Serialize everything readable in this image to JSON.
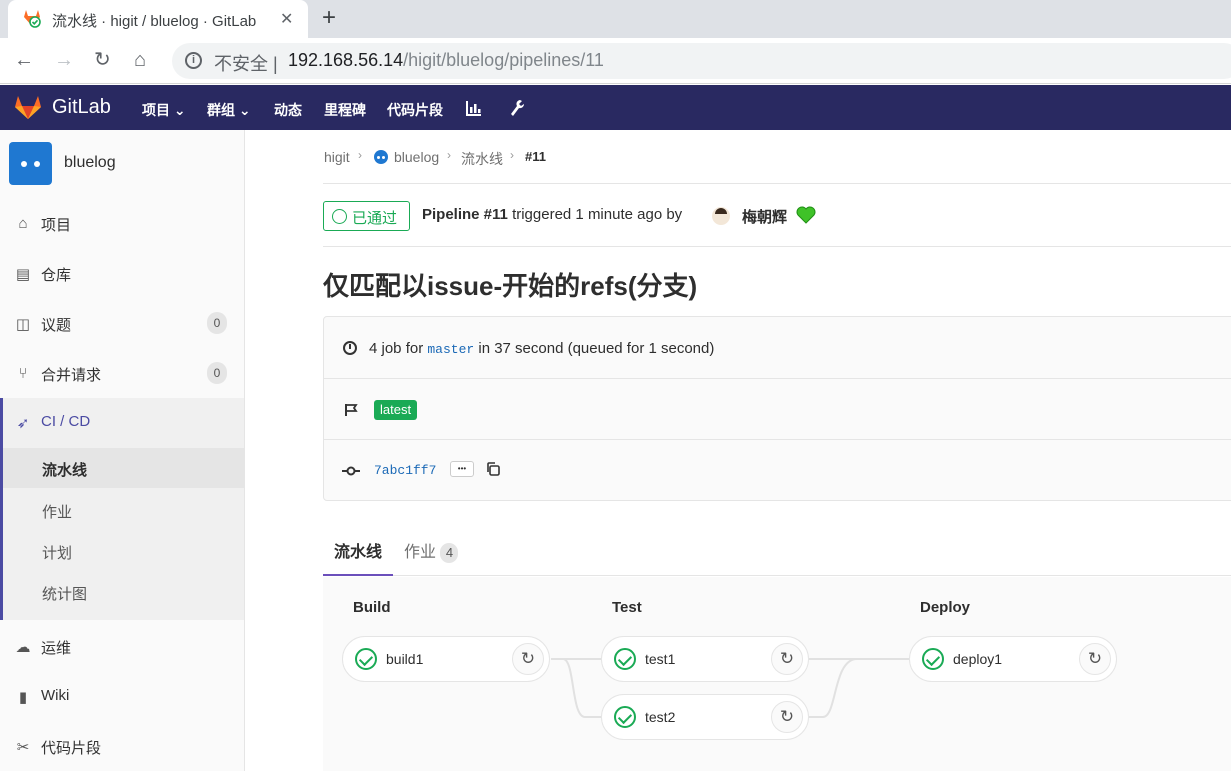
{
  "browser": {
    "tab_title": "流水线 · higit / bluelog · GitLab",
    "tab_close": "✕",
    "new_tab": "+",
    "nav": {
      "back": "←",
      "forward": "→",
      "reload": "↻",
      "home": "⌂"
    },
    "security_label": "不安全",
    "url_host": "192.168.56.14",
    "url_path": "/higit/bluelog/pipelines/11"
  },
  "header": {
    "brand": "GitLab",
    "nav": [
      "项目",
      "群组",
      "动态",
      "里程碑",
      "代码片段"
    ]
  },
  "sidebar": {
    "project_name": "bluelog",
    "items": [
      {
        "label": "项目",
        "icon": "home-icon"
      },
      {
        "label": "仓库",
        "icon": "doc-icon"
      },
      {
        "label": "议题",
        "icon": "issues-icon",
        "count": "0"
      },
      {
        "label": "合并请求",
        "icon": "merge-request-icon",
        "count": "0"
      },
      {
        "label": "CI / CD",
        "icon": "rocket-icon"
      },
      {
        "label": "运维",
        "icon": "cloud-gear-icon"
      },
      {
        "label": "Wiki",
        "icon": "book-icon"
      },
      {
        "label": "代码片段",
        "icon": "scissors-icon"
      }
    ],
    "cicd_sub": [
      "流水线",
      "作业",
      "计划",
      "统计图"
    ]
  },
  "breadcrumb": [
    "higit",
    "bluelog",
    "流水线",
    "#11"
  ],
  "pipeline": {
    "status": "已通过",
    "pipeline_label": "Pipeline #11",
    "triggered": "triggered 1 minute ago by",
    "user": "梅朝辉",
    "title": "仅匹配以issue-开始的refs(分支)",
    "job_count_text": "4 job for",
    "branch": "master",
    "duration_text": "in 37 second (queued for 1 second)",
    "tag": "latest",
    "commit": "7abc1ff7",
    "ellipsis": "•••"
  },
  "tabs": {
    "pipeline": "流水线",
    "jobs": "作业",
    "jobs_count": "4"
  },
  "stages": [
    {
      "name": "Build",
      "jobs": [
        "build1"
      ]
    },
    {
      "name": "Test",
      "jobs": [
        "test1",
        "test2"
      ]
    },
    {
      "name": "Deploy",
      "jobs": [
        "deploy1"
      ]
    }
  ],
  "colors": {
    "header_bg": "#292961",
    "success": "#1aaa55",
    "accent": "#6b4fbb"
  }
}
